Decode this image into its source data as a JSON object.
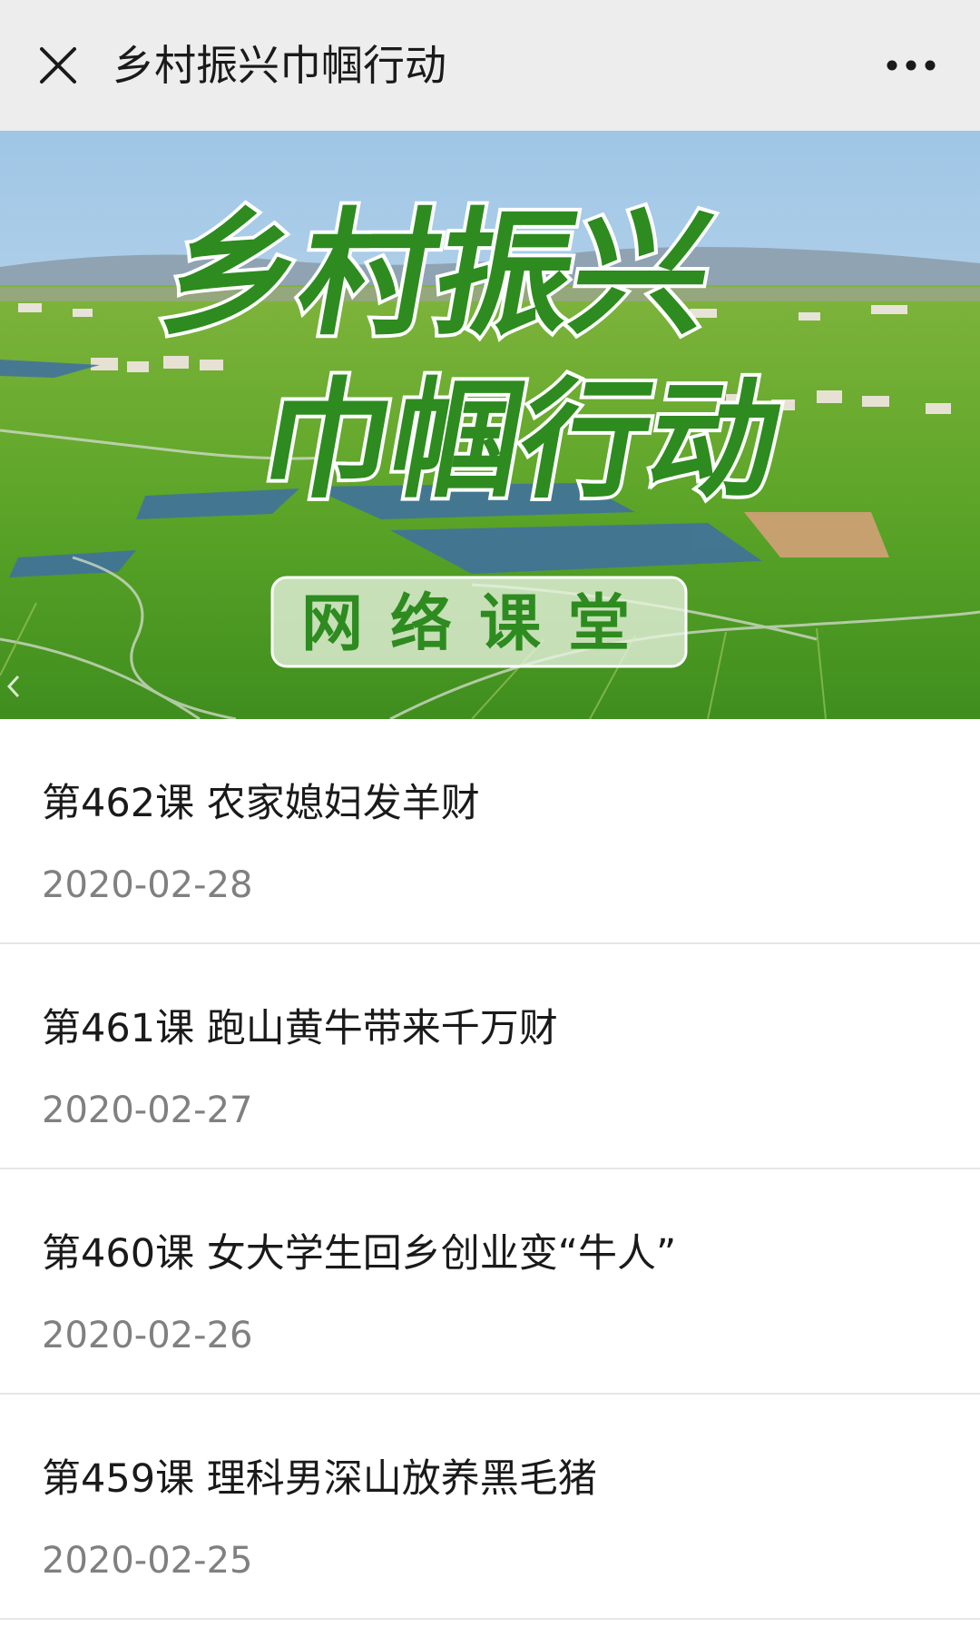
{
  "header": {
    "title": "乡村振兴巾帼行动",
    "close_icon": "close-icon",
    "more_icon": "more-horizontal-icon"
  },
  "banner": {
    "title_line1": "乡村振兴",
    "title_line2": "巾帼行动",
    "subtitle": "网络课堂",
    "prev_icon": "chevron-left-icon",
    "brand_green": "#2e8b1f"
  },
  "articles": [
    {
      "title": "第462课 农家媳妇发羊财",
      "date": "2020-02-28"
    },
    {
      "title": "第461课 跑山黄牛带来千万财",
      "date": "2020-02-27"
    },
    {
      "title": "第460课 女大学生回乡创业变“牛人”",
      "date": "2020-02-26"
    },
    {
      "title": "第459课 理科男深山放养黑毛猪",
      "date": "2020-02-25"
    }
  ]
}
